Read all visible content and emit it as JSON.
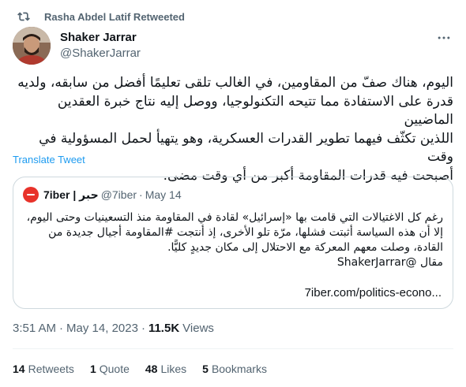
{
  "retweet": {
    "text": "Rasha Abdel Latif Retweeted"
  },
  "author": {
    "name": "Shaker Jarrar",
    "handle": "@ShakerJarrar"
  },
  "tweet": {
    "lines": [
      "اليوم، هناك صفّ من المقاومين، في الغالب تلقى تعليمًا أفضل من سابقه، ولديه",
      "قدرة على الاستفادة مما تتيحه التكنولوجيا، ووصل إليه نتاج خبرة العقدين الماضيين",
      "اللذين تكثّف فيهما تطوير القدرات العسكرية، وهو يتهيأ لحمل المسؤولية في وقت",
      "أصبحت فيه قدرات المقاومة أكبر من أي وقت مضى."
    ],
    "translate_label": "Translate Tweet"
  },
  "quote": {
    "name": "7iber | حبر",
    "handle": "@7iber",
    "dot": "·",
    "date": "May 14",
    "lines": [
      "رغم كل الاغتيالات التي قامت بها «إسرائيل» لقادة في المقاومة منذ التسعينيات وحتى اليوم،",
      "إلا أن هذه السياسة أثبتت فشلها، مرّة تلو الأخرى، إذ أنتجت #المقاومة أجيال جديدة من",
      "القادة، وصلت معهم المعركة مع الاحتلال إلى مكان جديدٍ كليًّا.",
      "مقال @ShakerJarrar"
    ],
    "link": "7iber.com/politics-econo..."
  },
  "meta": {
    "time": "3:51 AM",
    "sep": "·",
    "date": "May 14, 2023",
    "sep2": "·",
    "views_count": "11.5K",
    "views_label": "Views"
  },
  "stats": [
    {
      "count": "14",
      "label": "Retweets"
    },
    {
      "count": "1",
      "label": "Quote"
    },
    {
      "count": "48",
      "label": "Likes"
    },
    {
      "count": "5",
      "label": "Bookmarks"
    }
  ],
  "colors": {
    "accent": "#1d9bf0",
    "secondary_text": "#536471",
    "quote_brand": "#e8322a"
  }
}
